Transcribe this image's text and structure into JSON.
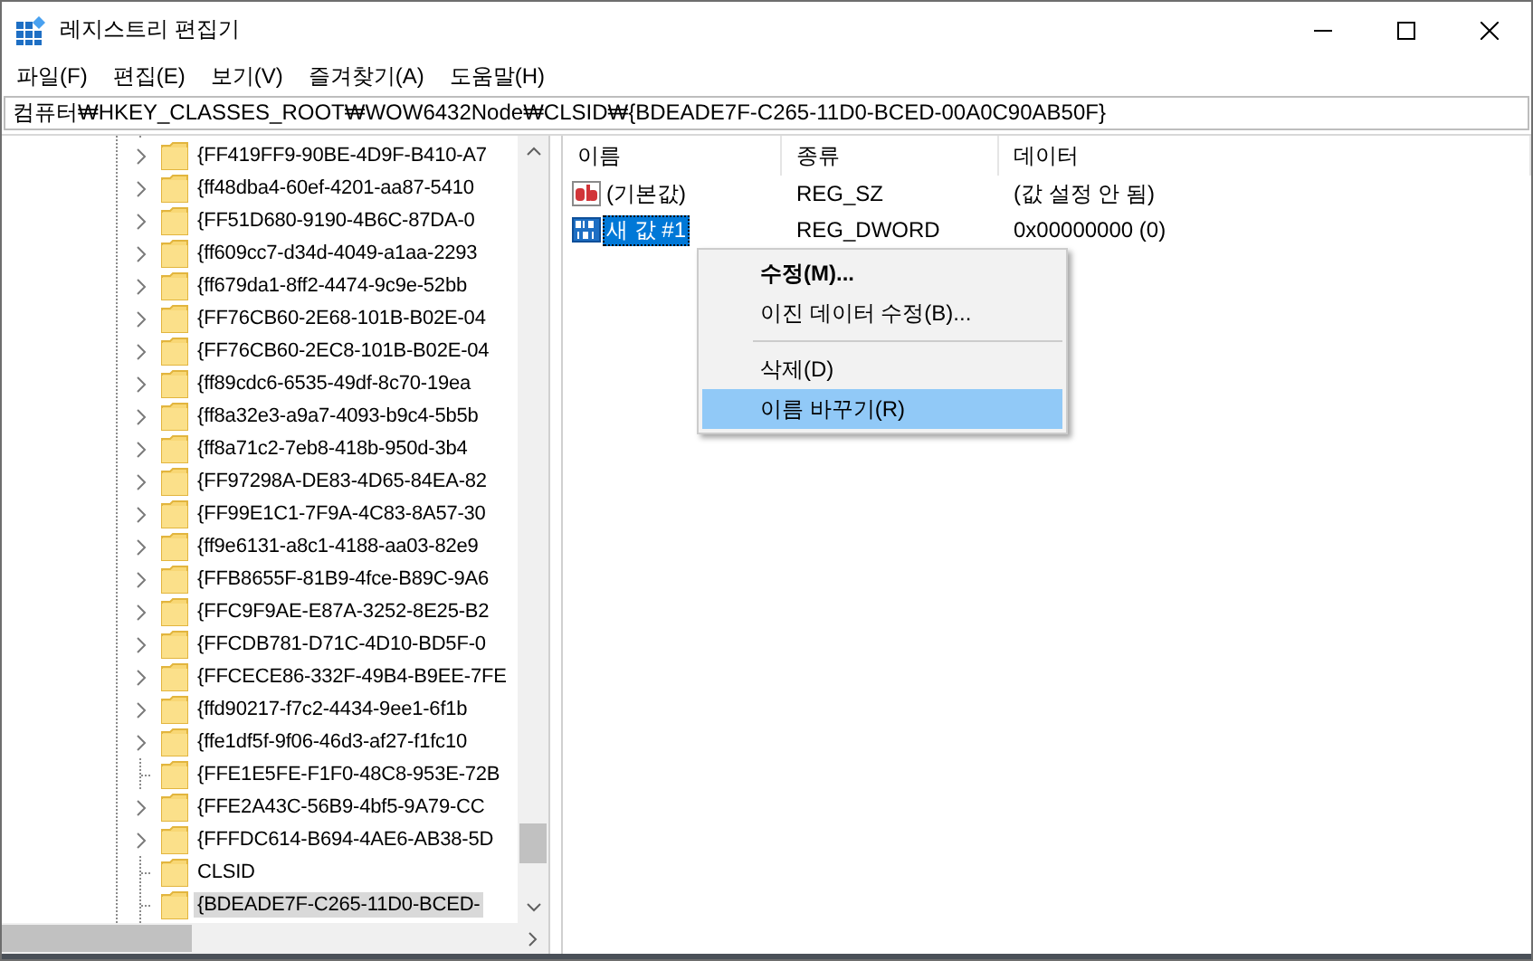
{
  "window": {
    "title": "레지스트리 편집기"
  },
  "menu_bar": [
    "파일(F)",
    "편집(E)",
    "보기(V)",
    "즐겨찾기(A)",
    "도움말(H)"
  ],
  "address": "컴퓨터₩HKEY_CLASSES_ROOT₩WOW6432Node₩CLSID₩{BDEADE7F-C265-11D0-BCED-00A0C90AB50F}",
  "tree": {
    "items": [
      {
        "label": "{FF419FF9-90BE-4D9F-B410-A7",
        "expandable": true,
        "selected": false
      },
      {
        "label": "{ff48dba4-60ef-4201-aa87-5410",
        "expandable": true,
        "selected": false
      },
      {
        "label": "{FF51D680-9190-4B6C-87DA-0",
        "expandable": true,
        "selected": false
      },
      {
        "label": "{ff609cc7-d34d-4049-a1aa-2293",
        "expandable": true,
        "selected": false
      },
      {
        "label": "{ff679da1-8ff2-4474-9c9e-52bb",
        "expandable": true,
        "selected": false
      },
      {
        "label": "{FF76CB60-2E68-101B-B02E-04",
        "expandable": true,
        "selected": false
      },
      {
        "label": "{FF76CB60-2EC8-101B-B02E-04",
        "expandable": true,
        "selected": false
      },
      {
        "label": "{ff89cdc6-6535-49df-8c70-19ea",
        "expandable": true,
        "selected": false
      },
      {
        "label": "{ff8a32e3-a9a7-4093-b9c4-5b5b",
        "expandable": true,
        "selected": false
      },
      {
        "label": "{ff8a71c2-7eb8-418b-950d-3b4",
        "expandable": true,
        "selected": false
      },
      {
        "label": "{FF97298A-DE83-4D65-84EA-82",
        "expandable": true,
        "selected": false
      },
      {
        "label": "{FF99E1C1-7F9A-4C83-8A57-30",
        "expandable": true,
        "selected": false
      },
      {
        "label": "{ff9e6131-a8c1-4188-aa03-82e9",
        "expandable": true,
        "selected": false
      },
      {
        "label": "{FFB8655F-81B9-4fce-B89C-9A6",
        "expandable": true,
        "selected": false
      },
      {
        "label": "{FFC9F9AE-E87A-3252-8E25-B2",
        "expandable": true,
        "selected": false
      },
      {
        "label": "{FFCDB781-D71C-4D10-BD5F-0",
        "expandable": true,
        "selected": false
      },
      {
        "label": "{FFCECE86-332F-49B4-B9EE-7FE",
        "expandable": true,
        "selected": false
      },
      {
        "label": "{ffd90217-f7c2-4434-9ee1-6f1b",
        "expandable": true,
        "selected": false
      },
      {
        "label": "{ffe1df5f-9f06-46d3-af27-f1fc10",
        "expandable": true,
        "selected": false
      },
      {
        "label": "{FFE1E5FE-F1F0-48C8-953E-72B",
        "expandable": false,
        "selected": false
      },
      {
        "label": "{FFE2A43C-56B9-4bf5-9A79-CC",
        "expandable": true,
        "selected": false
      },
      {
        "label": "{FFFDC614-B694-4AE6-AB38-5D",
        "expandable": true,
        "selected": false
      },
      {
        "label": "CLSID",
        "expandable": false,
        "selected": false
      },
      {
        "label": "{BDEADE7F-C265-11D0-BCED-",
        "expandable": false,
        "selected": true
      }
    ]
  },
  "values": {
    "columns": [
      "이름",
      "종류",
      "데이터"
    ],
    "rows": [
      {
        "name": "(기본값)",
        "type": "REG_SZ",
        "data": "(값 설정 안 됨)",
        "kind": "string",
        "selected": false
      },
      {
        "name": "새 값 #1",
        "type": "REG_DWORD",
        "data": "0x00000000 (0)",
        "kind": "dword",
        "selected": true
      }
    ]
  },
  "context_menu": {
    "items": [
      {
        "kind": "default",
        "label": "수정(M)...",
        "selected": false
      },
      {
        "kind": "item",
        "label": "이진 데이터 수정(B)...",
        "selected": false
      },
      {
        "kind": "separator"
      },
      {
        "kind": "item",
        "label": "삭제(D)",
        "selected": false
      },
      {
        "kind": "item",
        "label": "이름 바꾸기(R)",
        "selected": true
      }
    ]
  }
}
